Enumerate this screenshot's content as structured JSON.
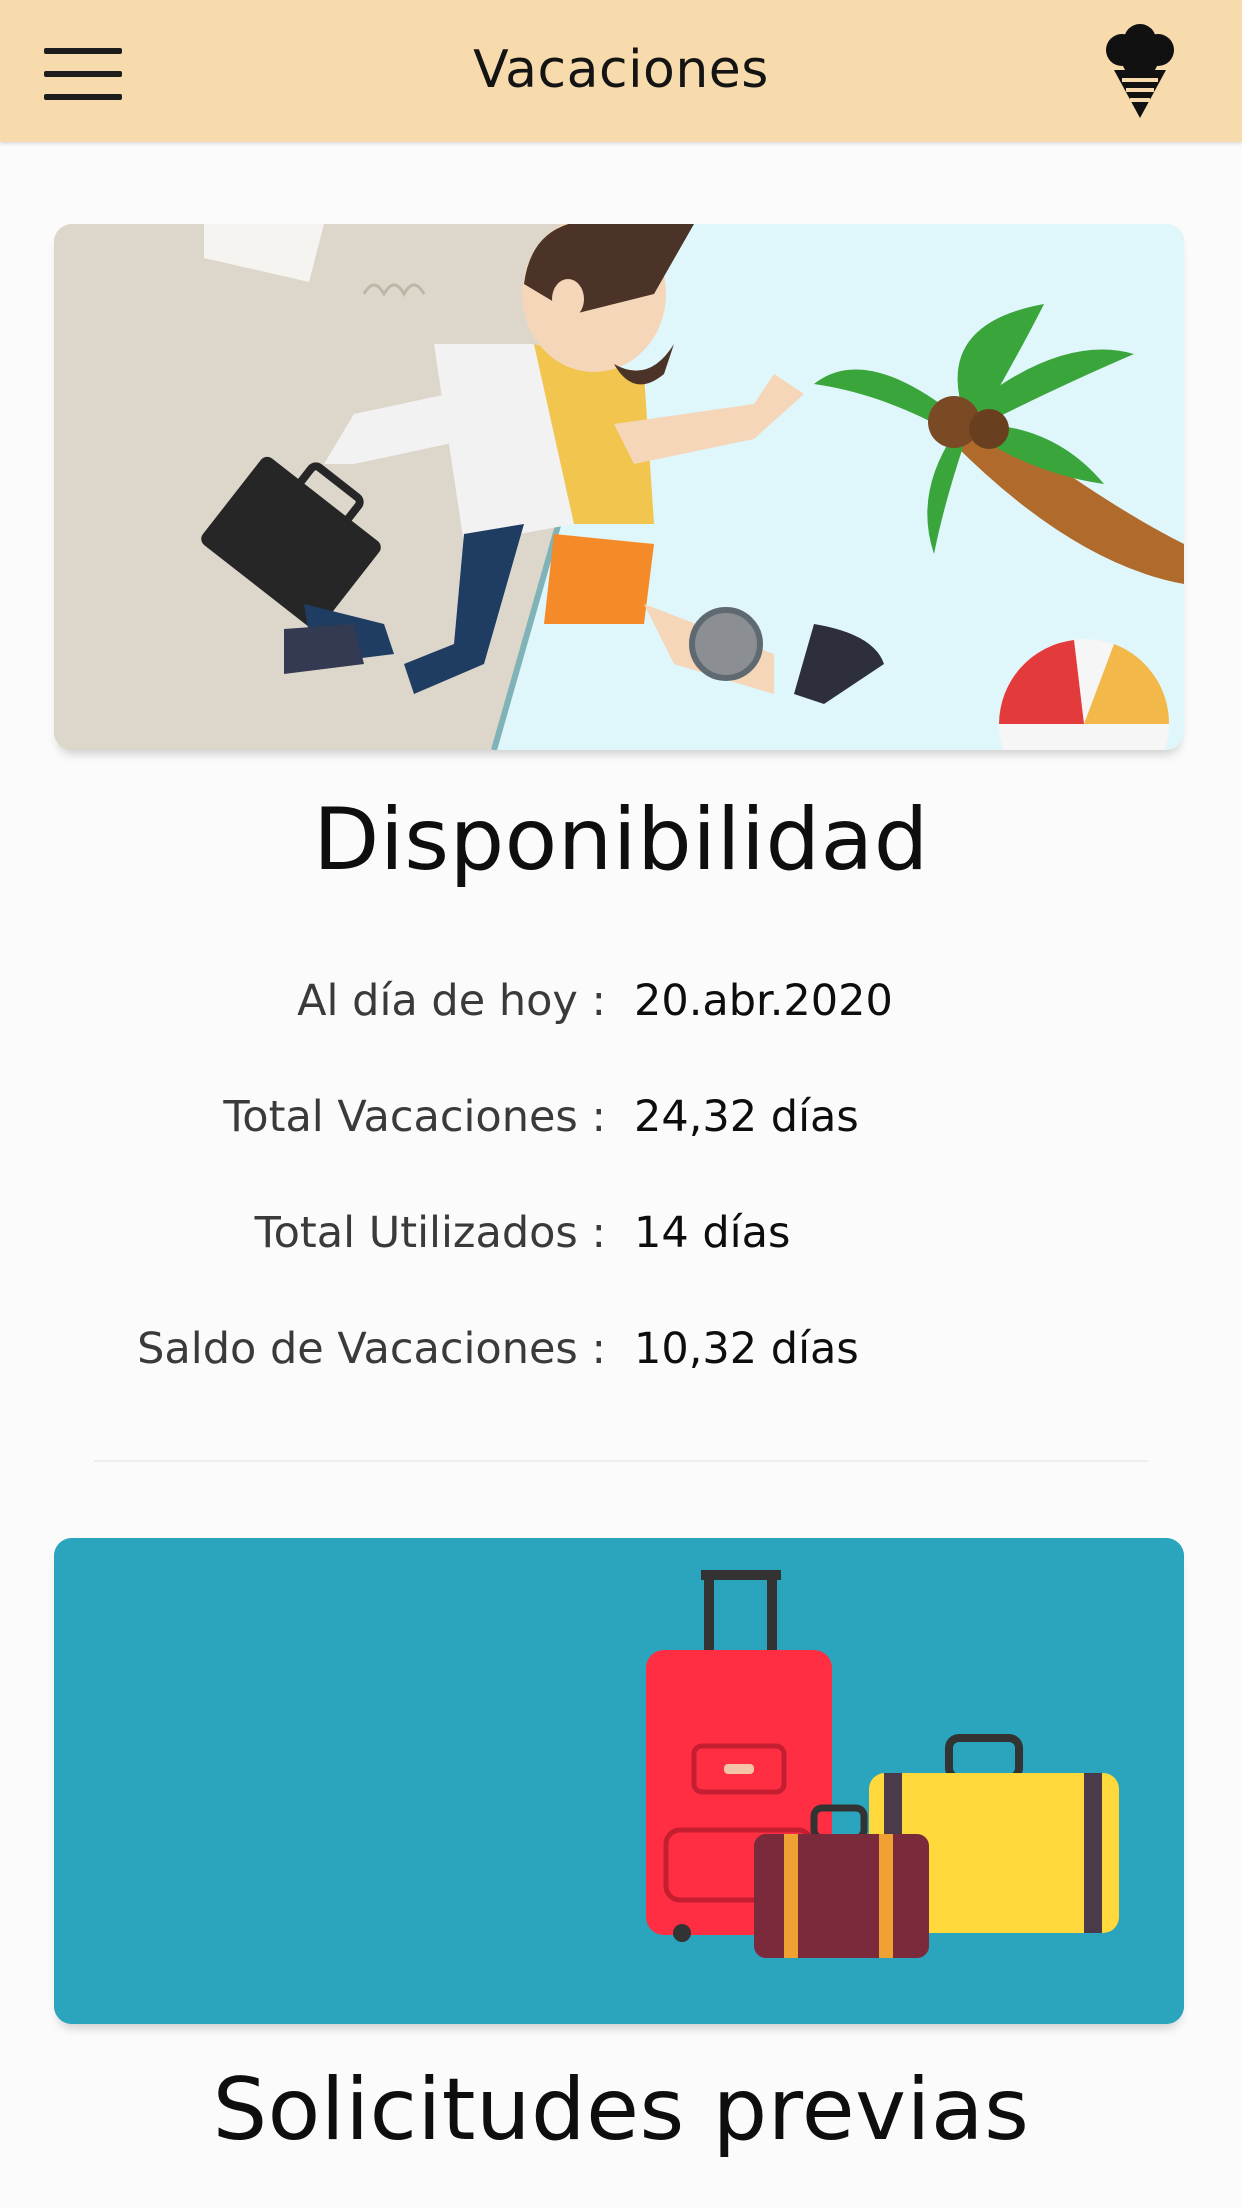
{
  "header": {
    "title": "Vacaciones",
    "menu_icon": "hamburger-menu-icon",
    "logo_icon": "ice-cream-cone-icon",
    "background_color": "#f7dbad"
  },
  "availability": {
    "banner_image": "office-to-beach-illustration",
    "title": "Disponibilidad",
    "rows": [
      {
        "label": "Al día de hoy :",
        "value": "20.abr.2020"
      },
      {
        "label": "Total Vacaciones :",
        "value": "24,32 días"
      },
      {
        "label": "Total Utilizados :",
        "value": "14 días"
      },
      {
        "label": "Saldo de Vacaciones :",
        "value": "10,32 días"
      }
    ]
  },
  "requests": {
    "banner_image": "suitcases-illustration",
    "banner_color": "#2aa5bd",
    "title": "Solicitudes previas"
  }
}
